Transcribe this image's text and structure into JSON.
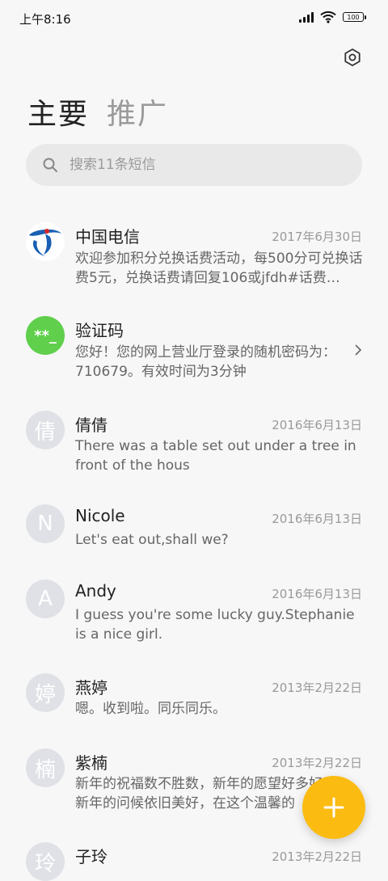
{
  "status_bar": {
    "time": "上午8:16",
    "battery": "100"
  },
  "tabs": [
    {
      "label": "主要"
    },
    {
      "label": "推广"
    }
  ],
  "search": {
    "placeholder": "搜索11条短信"
  },
  "messages": [
    {
      "name": "中国电信",
      "date": "2017年6月30日",
      "preview": "欢迎参加积分兑换话费活动，每500分可兑换话费5元，兑换话费请回复106或jfdh#话费…",
      "avatar_type": "logo"
    },
    {
      "name": "验证码",
      "date": "",
      "preview": "您好！您的网上营业厅登录的随机密码为：710679。有效时间为3分钟",
      "avatar_type": "code",
      "avatar_text": "**_"
    },
    {
      "name": "倩倩",
      "date": "2016年6月13日",
      "preview": "There was a table set out under a tree in front of the hous",
      "avatar_text": "倩"
    },
    {
      "name": "Nicole",
      "date": "2016年6月13日",
      "preview": "Let's eat out,shall we?",
      "avatar_text": "N"
    },
    {
      "name": "Andy",
      "date": "2016年6月13日",
      "preview": "I guess you're some lucky guy.Stephanie is a nice girl.",
      "avatar_text": "A"
    },
    {
      "name": "燕婷",
      "date": "2013年2月22日",
      "preview": "嗯。收到啦。同乐同乐。",
      "avatar_text": "婷"
    },
    {
      "name": "紫楠",
      "date": "2013年2月22日",
      "preview": "新年的祝福数不胜数，新年的愿望好多好多，新年的问候依旧美好，在这个温馨的",
      "avatar_text": "楠"
    },
    {
      "name": "子玲",
      "date": "2013年2月22日",
      "preview": "",
      "avatar_text": "玲"
    }
  ],
  "colors": {
    "accent_fab": "#fbbb11",
    "verify_avatar": "#5fcf4c",
    "telecom_blue": "#1a5fb4",
    "telecom_red": "#d6262b"
  }
}
